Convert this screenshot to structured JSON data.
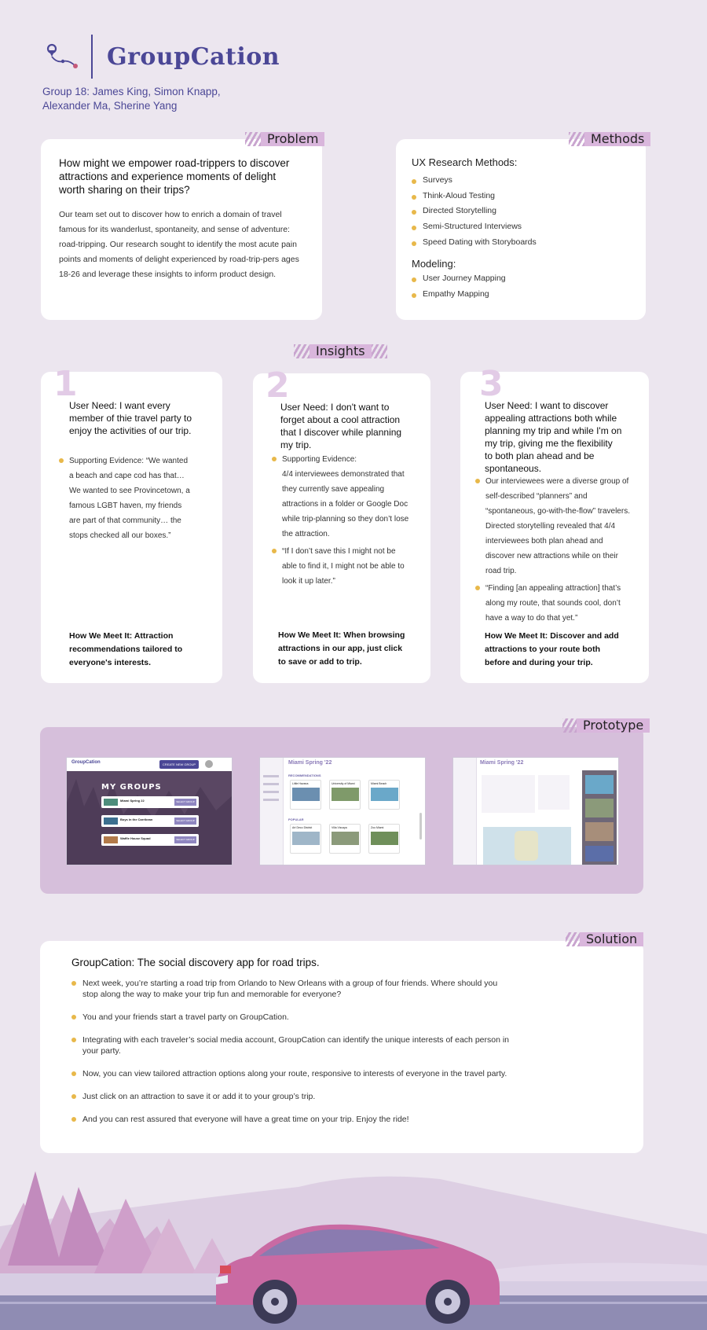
{
  "brand": {
    "name": "GroupCation",
    "color": "#4b4796"
  },
  "authors": "Group 18: James King, Simon Knapp, Alexander Ma, Sherine Yang",
  "problem": {
    "tag": "Problem",
    "question": "How might we empower road-trippers to discover attractions and experience moments of delight worth sharing on their trips?",
    "body": "Our team set out to discover how to enrich a domain of travel famous for its wanderlust, spontaneity, and sense of adventure: road-tripping.  Our research sought to identify the most acute pain points and moments of delight experienced by road-trip-pers ages 18-26 and leverage these insights to inform product design."
  },
  "methods": {
    "tag": "Methods",
    "ux_title": "UX Research Methods:",
    "ux_items": [
      "Surveys",
      "Think-Aloud Testing",
      "Directed Storytelling",
      "Semi-Structured Interviews",
      "Speed Dating with Storyboards"
    ],
    "modeling_title": "Modeling:",
    "modeling_items": [
      "User Journey Mapping",
      "Empathy Mapping"
    ]
  },
  "insights": {
    "tag": "Insights",
    "cards": [
      {
        "num": "1",
        "need": "User Need: I want every member of thie travel party to enjoy the activities of our trip.",
        "evidence": [
          "Supporting Evidence:    “We wanted a beach and cape cod has that… We wanted to see Provincetown, a famous LGBT haven, my friends are part of that community… the stops checked all our boxes.”"
        ],
        "how": "How We Meet It: Attraction recommendations tailored to everyone's interests."
      },
      {
        "num": "2",
        "need": "User Need: I don't want to forget about a cool attraction that I discover while planning my trip.",
        "evidence": [
          "Supporting Evidence:",
          "4/4 interviewees demonstrated that they currently save appealing attractions in a folder or Google Doc while trip-planning so they don’t lose the attraction.",
          "“If I don’t save this I might not be able to find it, I might not be able to look it up later.”"
        ],
        "how": "How We Meet It: When browsing attractions in our app, just click to save or add to trip."
      },
      {
        "num": "3",
        "need": "User Need: I want to discover appealing attractions both while planning my trip and while I'm on my trip, giving me the flexibility to both plan ahead and be spontaneous.",
        "evidence": [
          "Our interviewees were a diverse group of self-described “planners” and “spontaneous, go-with-the-flow” travelers. Directed storytelling revealed that 4/4 interviewees both plan ahead and discover new attractions while on their road trip.",
          "“Finding [an appealing attraction] that’s along my route, that sounds cool, don’t have a way to do that yet.”"
        ],
        "how": "How We Meet It: Discover and add attractions to your route both before and during your trip."
      }
    ]
  },
  "prototype": {
    "tag": "Prototype",
    "screen1": {
      "logo": "GroupCation",
      "create_btn": "CREATE NEW GROUP",
      "title": "MY GROUPS",
      "groups": [
        "Miami Spring 22",
        "Boys in the Carribean",
        "Waffle House Squad"
      ],
      "select_btn": "SELECT GROUP"
    },
    "screen2": {
      "trip": "Miami Spring '22",
      "section1": "RECOMMENDATIONS",
      "rec_titles": [
        "Little Havana",
        "University of Miami",
        "Miami Beach"
      ],
      "section2": "POPULAR",
      "pop_titles": [
        "Art Deco District",
        "Villa Vizcaya",
        "Zoo Miami"
      ]
    },
    "screen3": {
      "trip": "Miami Spring '22"
    }
  },
  "solution": {
    "tag": "Solution",
    "title": "GroupCation: The social discovery app for road trips.",
    "items": [
      "Next week, you’re starting a road trip from Orlando to New Orleans with a group of four friends. Where should you stop along the way to make your trip fun and memorable for everyone?",
      "You and your friends start a travel party on GroupCation.",
      "Integrating with each traveler’s social media account, GroupCation can identify the unique interests of each person in your party.",
      "Now, you can view tailored attraction options along your route, responsive to interests of everyone in the travel party.",
      "Just click on an attraction to save it or add it to your group’s trip.",
      "And you can rest assured that everyone will have a great time on your trip.  Enjoy the ride!"
    ]
  },
  "colors": {
    "accent_purple": "#d9b6dc",
    "bullet_yellow": "#e8b84a",
    "background": "#ece6ef"
  }
}
